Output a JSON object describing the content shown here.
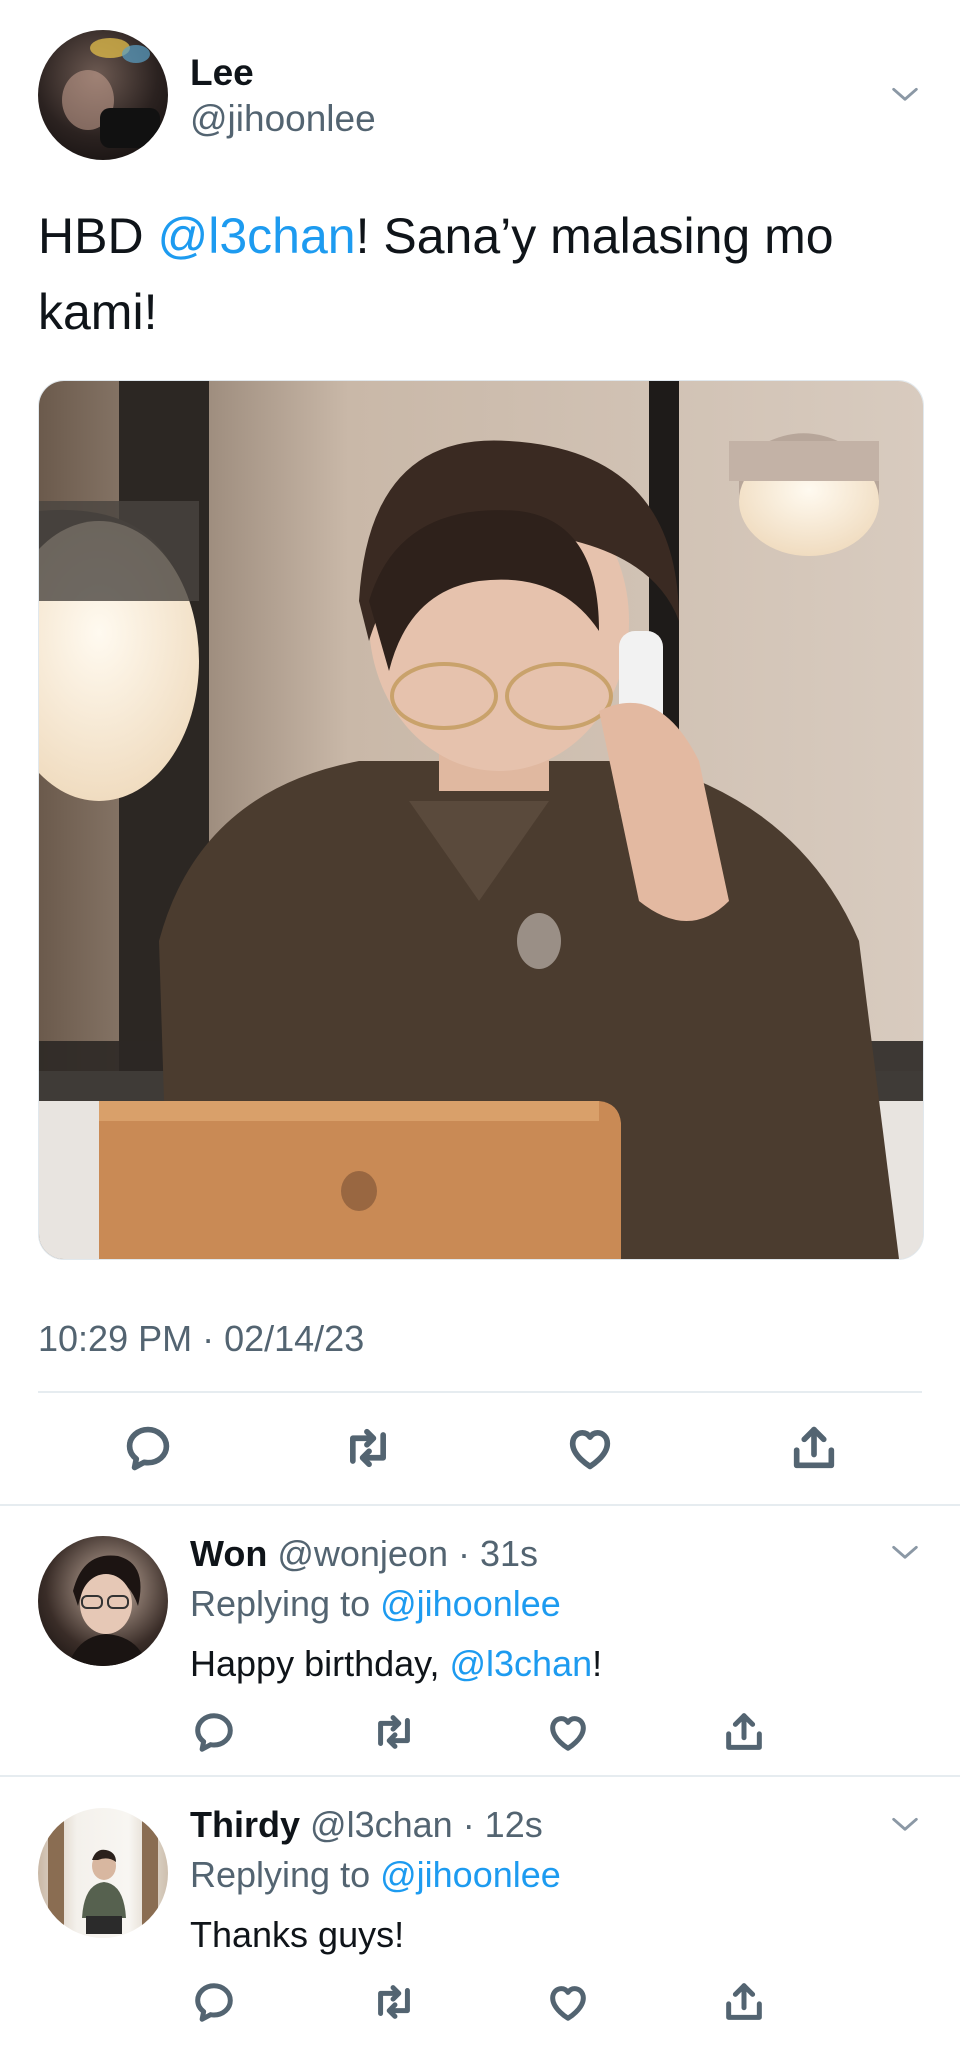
{
  "tweet": {
    "author": {
      "name": "Lee",
      "handle": "@jihoonlee"
    },
    "text_prefix": "HBD ",
    "mention": "@l3chan",
    "text_suffix": "! Sana’y malasing mo",
    "text_line2": "kami!",
    "timestamp": "10:29 PM · 02/14/23"
  },
  "replies": [
    {
      "name": "Won",
      "handle": "@wonjeon",
      "time": "· 31s",
      "replying_label": "Replying to ",
      "replying_to": "@jihoonlee",
      "text_prefix": "Happy birthday, ",
      "mention": "@l3chan",
      "text_suffix": "!"
    },
    {
      "name": "Thirdy",
      "handle": "@l3chan",
      "time": "· 12s",
      "replying_label": "Replying to ",
      "replying_to": "@jihoonlee",
      "text": "Thanks guys!"
    }
  ],
  "actions": [
    "reply-icon",
    "retweet-icon",
    "like-icon",
    "share-icon"
  ],
  "colors": {
    "accent": "#1d9bf0",
    "muted": "#536471",
    "divider": "#e6ecf0",
    "text": "#0f1419"
  }
}
